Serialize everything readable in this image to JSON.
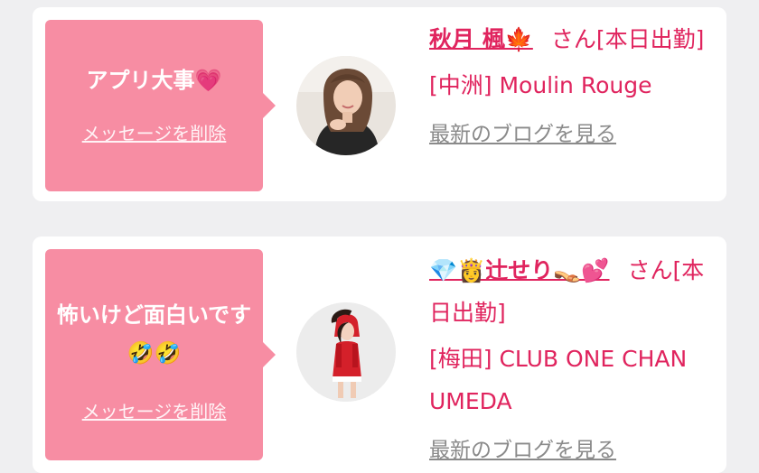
{
  "cards": [
    {
      "message": "アプリ大事💗",
      "delete_label": "メッセージを削除",
      "name": "秋月 楓🍁",
      "suffix": "さん[本日出勤]",
      "shop": "[中洲] Moulin Rouge",
      "blog_label": "最新のブログを見る",
      "avatar": "portrait-woman-black-sweater"
    },
    {
      "message": "怖いけど面白いです🤣🤣",
      "delete_label": "メッセージを削除",
      "name": "💎👸辻せり👡💕",
      "suffix": "さん[本日出勤]",
      "shop": "[梅田] CLUB ONE CHAN UMEDA",
      "blog_label": "最新のブログを見る",
      "avatar": "portrait-woman-santa-dress"
    }
  ],
  "colors": {
    "bubble": "#f78da3",
    "accent": "#e0245e",
    "link_gray": "#8a8a8a",
    "background": "#efeff1"
  }
}
